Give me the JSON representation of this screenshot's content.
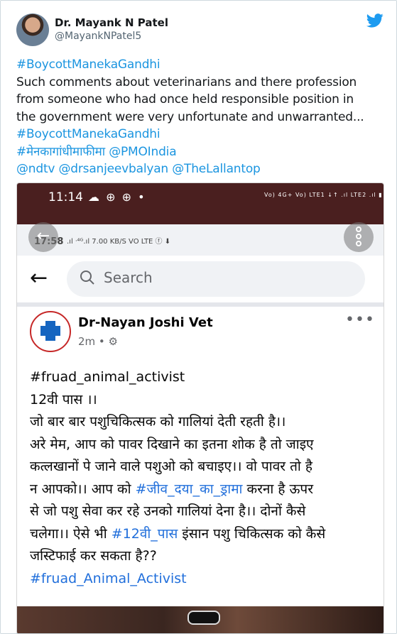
{
  "tweet": {
    "author_name": "Dr. Mayank N Patel",
    "author_handle": "@MayankNPatel5",
    "lines": [
      {
        "text": "#BoycottManekaGandhi",
        "highlight": true
      },
      {
        "text": "Such comments about veterinarians and there profession",
        "highlight": false
      },
      {
        "text": "from someone who had once held responsible position in",
        "highlight": false
      },
      {
        "text": "the government were very  unfortunate and unwarranted...",
        "highlight": false
      },
      {
        "text": "#BoycottManekaGandhi",
        "highlight": true
      },
      {
        "text": "#मेनकागांधीमाफीमा @PMOIndia",
        "highlight": true
      },
      {
        "text": "@ndtv @drsanjeevbalyan @TheLallantop",
        "highlight": true
      }
    ]
  },
  "embedded_screenshot": {
    "status_time": "11:14",
    "status_icons": "☁ ⊕ ⊕ •",
    "status_right": "Vo) 4G+ Vo) LTE1 ↓↑ .ıl LTE2 .ıl ▮",
    "inner_status_time": "17:58",
    "inner_status_icons": ".ıl ᐧ⁴ᴳ.ıl 7.00 KB/S VO LTE ⓕ ⬇",
    "search_placeholder": "Search",
    "post_author": "Dr-Nayan Joshi Vet",
    "post_time": "2m • ⚙",
    "post_more": "•••",
    "post_lines": [
      {
        "text": "#fruad_animal_activist",
        "tag": false
      },
      {
        "text": "12वी पास ।।",
        "tag": false
      },
      {
        "text": "जो बार बार पशुचिकित्सक को गालियां देती रहती है।।",
        "tag": false
      },
      {
        "text": "अरे मेम, आप को पावर दिखाने का इतना शोक है तो जाइए",
        "tag": false
      },
      {
        "text": "कत्लखानों पे जाने वाले पशुओ को बचाइए।। वो पावर तो है",
        "tag": false
      },
      {
        "pre": "न आपको।। आप को ",
        "tag_text": "#जीव_दया_का_ड्रामा",
        "post": " करना है ऊपर",
        "mixed": true
      },
      {
        "text": "से जो पशु  सेवा कर रहे उनको गालियां देना है।। दोनों कैसे",
        "tag": false
      },
      {
        "pre": "चलेगा।। ऐसे भी ",
        "tag_text": "#12वी_पास",
        "post": " इंसान पशु चिकित्सक को कैसे",
        "mixed": true
      },
      {
        "text": "जस्टिफाई कर सकता है??",
        "tag": false
      },
      {
        "text": " #fruad_Animal_Activist",
        "tag": true
      }
    ]
  },
  "colors": {
    "link": "#1b95e0",
    "twitter_blue": "#1d9bf0",
    "fb_hashtag": "#216fdb",
    "status_bar": "#4a1f1f"
  },
  "icons": [
    "twitter-bird-icon",
    "back-arrow-icon",
    "search-icon",
    "more-icon",
    "settings-gear-icon",
    "menu-dots-icon"
  ]
}
